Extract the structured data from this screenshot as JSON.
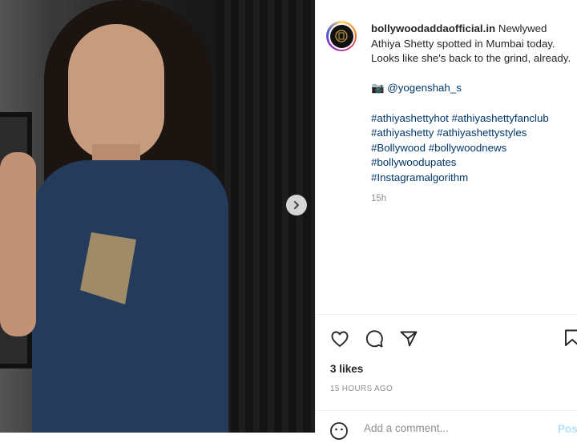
{
  "post": {
    "username": "bollywoodaddaofficial.in",
    "caption_line1": "Newlywed Athiya Shetty spotted in Mumbai today. Looks like she's back to the grind, already.",
    "camera_emoji": "📷",
    "photo_credit": "@yogenshah_s",
    "hashtags": [
      "#athiyashettyhot",
      "#athiyashettyfanclub",
      "#athiyashetty",
      "#athiyashettystyles",
      "#Bollywood",
      "#bollywoodnews",
      "#bollywoodupates",
      "#Instagramalgorithm"
    ],
    "time": "15h",
    "likes": "3 likes",
    "time_ago": "15 HOURS AGO"
  },
  "comment": {
    "placeholder": "Add a comment...",
    "post_label": "Post"
  },
  "icons": {
    "like": "heart-icon",
    "comment": "comment-icon",
    "share": "share-icon",
    "save": "bookmark-icon",
    "emoji": "emoji-icon",
    "next": "chevron-right-icon"
  },
  "colors": {
    "link": "#00376b",
    "muted": "#8e8e8e",
    "post_disabled": "#b2dffc",
    "shirt": "#243b5c"
  }
}
